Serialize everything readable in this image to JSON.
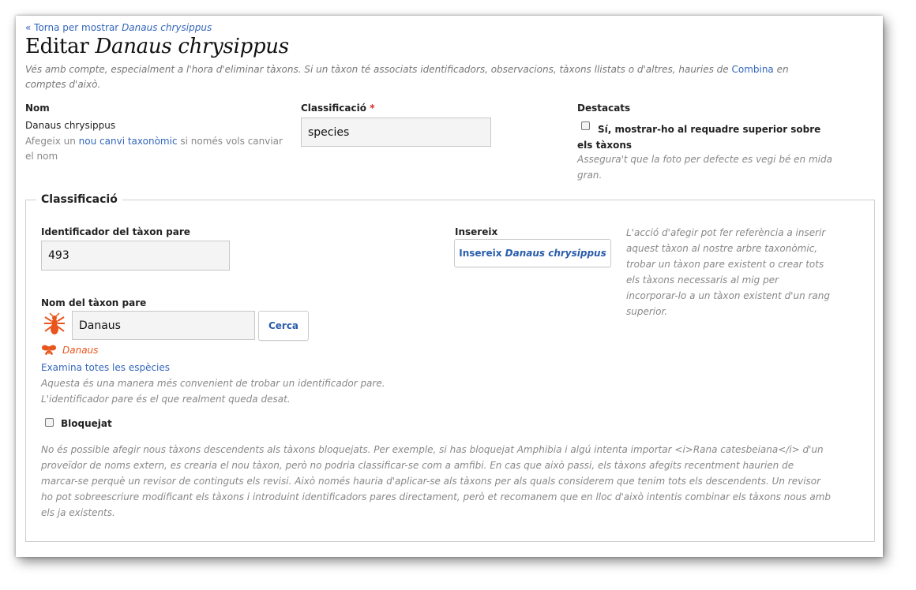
{
  "back_link": {
    "prefix": "« Torna per mostrar ",
    "taxon": "Danaus chrysippus"
  },
  "page_title": {
    "prefix": "Editar ",
    "taxon": "Danaus chrysippus"
  },
  "warning": {
    "text_before": "Vés amb compte, especialment a l'hora d'eliminar tàxons. Si un tàxon té associats identificadors, observacions, tàxons llistats o d'altres, hauries de ",
    "link": "Combina",
    "text_after": " en comptes d'això."
  },
  "name_field": {
    "label": "Nom",
    "value": "Danaus chrysippus",
    "help_before": "Afegeix un ",
    "help_link": "nou canvi taxonòmic",
    "help_after": " si només vols canviar el nom"
  },
  "rank_field": {
    "label": "Classificació",
    "required_mark": "*",
    "value": "species"
  },
  "featured_field": {
    "label": "Destacats",
    "checkbox_label": "Sí, mostrar-ho al requadre superior sobre els tàxons",
    "checked": false,
    "help": "Assegura't que la foto per defecte es vegi bé en mida gran."
  },
  "classification": {
    "legend": "Classificació",
    "parent_id": {
      "label": "Identificador del tàxon pare",
      "value": "493"
    },
    "insert": {
      "label": "Insereix",
      "button_prefix": "Insereix ",
      "button_taxon": "Danaus chrysippus",
      "help": "L'acció d'afegir pot fer referència a inserir aquest tàxon al nostre arbre taxonòmic, trobar un tàxon pare existent o crear tots els tàxons necessaris al mig per incorporar-lo a un tàxon existent d'un rang superior."
    },
    "parent_name": {
      "label": "Nom del tàxon pare",
      "value": "Danaus",
      "search_button": "Cerca",
      "selected_taxon": "Danaus",
      "browse_link": "Examina totes les espècies",
      "help": "Aquesta és una manera més convenient de trobar un identificador pare. L'identificador pare és el que realment queda desat."
    },
    "locked": {
      "label": "Bloquejat",
      "checked": false,
      "help": "No és possible afegir nous tàxons descendents als tàxons bloquejats. Per exemple, si has bloquejat Amphibia i algú intenta importar <i>Rana catesbeiana</i> d'un proveïdor de noms extern, es crearia el nou tàxon, però no podria classificar-se com a amfibi. En cas que això passi, els tàxons afegits recentment haurien de marcar-se perquè un revisor de continguts els revisi. Això només hauria d'aplicar-se als tàxons per als quals considerem que tenim tots els descendents. Un revisor ho pot sobreescriure modificant els tàxons i introduint identificadors pares directament, però et recomanem que en lloc d'això intentis combinar els tàxons nous amb els ja existents."
    }
  },
  "colors": {
    "link": "#3366bb",
    "insect_icon": "#e8561e",
    "required": "#dd2222"
  },
  "icons": {
    "parent_taxon_icon": "insect-icon",
    "selected_taxon_icon": "insect-icon"
  }
}
